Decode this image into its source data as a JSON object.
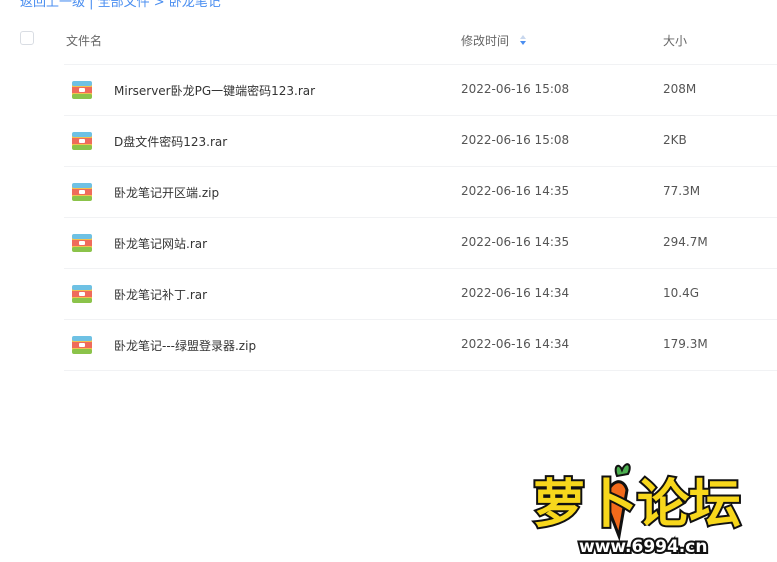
{
  "breadcrumb": "返回上一级 | 全部文件 > 卧龙笔记",
  "table": {
    "columns": {
      "name": "文件名",
      "modified": "修改时间",
      "size": "大小"
    },
    "rows": [
      {
        "name": "Mirserver卧龙PG一键端密码123.rar",
        "modified": "2022-06-16 15:08",
        "size": "208M",
        "icon": "archive-icon"
      },
      {
        "name": "D盘文件密码123.rar",
        "modified": "2022-06-16 15:08",
        "size": "2KB",
        "icon": "archive-icon"
      },
      {
        "name": "卧龙笔记开区端.zip",
        "modified": "2022-06-16 14:35",
        "size": "77.3M",
        "icon": "archive-icon"
      },
      {
        "name": "卧龙笔记网站.rar",
        "modified": "2022-06-16 14:35",
        "size": "294.7M",
        "icon": "archive-icon"
      },
      {
        "name": "卧龙笔记补丁.rar",
        "modified": "2022-06-16 14:34",
        "size": "10.4G",
        "icon": "archive-icon"
      },
      {
        "name": "卧龙笔记---绿盟登录器.zip",
        "modified": "2022-06-16 14:34",
        "size": "179.3M",
        "icon": "archive-icon"
      }
    ]
  },
  "watermark": {
    "title": "萝卜论坛",
    "url": "www.6994.cn"
  },
  "colors": {
    "accent": "#4a8ef0",
    "watermark_yellow": "#f7d71c",
    "watermark_outline": "#111111",
    "carrot_orange": "#f26a1b"
  }
}
